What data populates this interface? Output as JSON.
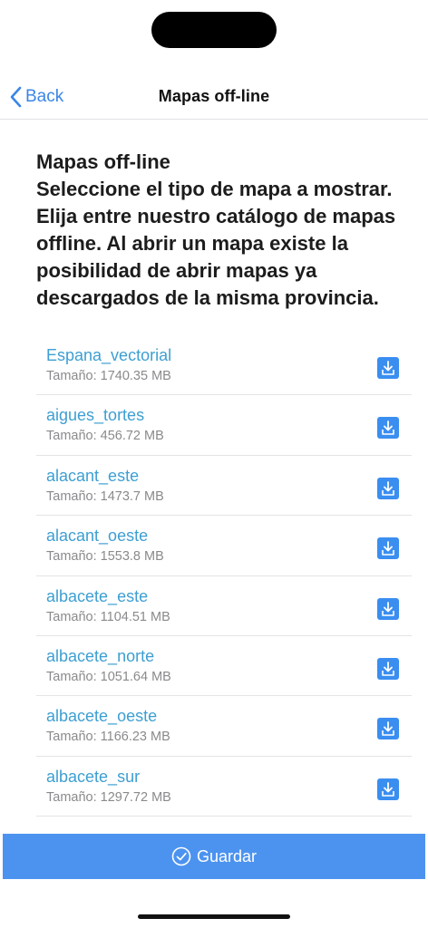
{
  "nav": {
    "back_label": "Back",
    "title": "Mapas off-line"
  },
  "heading": {
    "line1": "Mapas off-line",
    "line2": "Seleccione el tipo de mapa a mostrar. Elija entre nuestro catálogo de mapas offline. Al abrir un mapa existe la posibilidad de abrir mapas ya descargados de la misma provincia."
  },
  "maps": [
    {
      "name": "Espana_vectorial",
      "size": "Tamaño: 1740.35 MB"
    },
    {
      "name": "aigues_tortes",
      "size": "Tamaño: 456.72 MB"
    },
    {
      "name": "alacant_este",
      "size": "Tamaño: 1473.7 MB"
    },
    {
      "name": "alacant_oeste",
      "size": "Tamaño: 1553.8 MB"
    },
    {
      "name": "albacete_este",
      "size": "Tamaño: 1104.51 MB"
    },
    {
      "name": "albacete_norte",
      "size": "Tamaño: 1051.64 MB"
    },
    {
      "name": "albacete_oeste",
      "size": "Tamaño: 1166.23 MB"
    },
    {
      "name": "albacete_sur",
      "size": "Tamaño: 1297.72 MB"
    }
  ],
  "footer": {
    "save_label": "Guardar"
  },
  "colors": {
    "accent": "#3a86e6",
    "link": "#3d9fd2",
    "save_bar": "#4c93f0"
  },
  "icons": {
    "back": "chevron-left-icon",
    "download": "download-icon",
    "save": "check-circle-icon"
  }
}
